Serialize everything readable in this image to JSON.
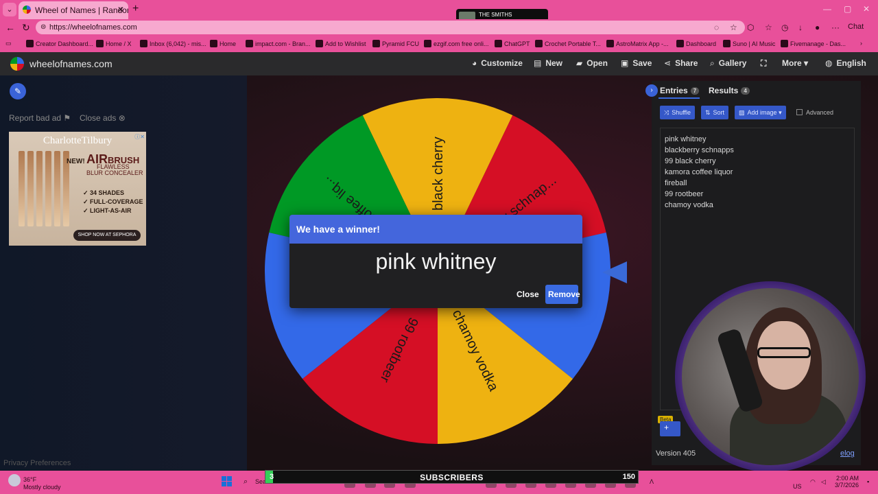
{
  "browser": {
    "tab_title": "Wheel of Names | Random name",
    "url": "https://wheelofnames.com",
    "chat_label": "Chat",
    "bookmarks": [
      "Creator Dashboard...",
      "Home / X",
      "Inbox (6,042) - mis...",
      "Home",
      "impact.com - Bran...",
      "Add to Wishlist",
      "Pyramid FCU",
      "ezgif.com free onli...",
      "ChatGPT",
      "Crochet Portable T...",
      "AstroMatrix App -...",
      "Dashboard",
      "Suno | AI Music",
      "Fivemanage - Das..."
    ]
  },
  "music": {
    "band": "THE SMITHS",
    "song": "I K"
  },
  "site": {
    "logo": "wheelofnames.com",
    "menu": {
      "customize": "Customize",
      "new": "New",
      "open": "Open",
      "save": "Save",
      "share": "Share",
      "gallery": "Gallery",
      "more": "More",
      "language": "English"
    }
  },
  "ads": {
    "report": "Report bad ad",
    "close": "Close ads",
    "brand": "CharlotteTilbury",
    "new": "NEW!",
    "air": "AIR",
    "brush": "BRUSH",
    "flawless": "FLAWLESS",
    "product": "BLUR CONCEALER",
    "bullets": [
      "✓ 34 SHADES",
      "✓ FULL-COVERAGE",
      "✓ LIGHT-AS-AIR"
    ],
    "cta": "SHOP NOW AT SEPHORA"
  },
  "privacy": "Privacy Preferences",
  "wheel": {
    "colors": [
      "#3369e8",
      "#d50f25",
      "#eeb211",
      "#009925"
    ],
    "segments": [
      {
        "label": "99 black cherry",
        "color": "#eeb211"
      },
      {
        "label": "blackberry schnap...",
        "color": "#d50f25"
      },
      {
        "label": "pink whitney",
        "color": "#3369e8"
      },
      {
        "label": "chamoy vodka",
        "color": "#eeb211"
      },
      {
        "label": "99 rootbeer",
        "color": "#d50f25"
      },
      {
        "label": "fireball",
        "color": "#3369e8"
      },
      {
        "label": "kamora coffee liq...",
        "color": "#009925"
      }
    ]
  },
  "dialog": {
    "title": "We have a winner!",
    "winner": "pink whitney",
    "close": "Close",
    "remove": "Remove"
  },
  "panel": {
    "tabs": {
      "entries": "Entries",
      "entries_count": "7",
      "results": "Results",
      "results_count": "4"
    },
    "buttons": {
      "shuffle": "Shuffle",
      "sort": "Sort",
      "add_image": "Add image",
      "advanced": "Advanced"
    },
    "entries": [
      "pink whitney",
      "blackberry schnapps",
      "99 black cherry",
      "kamora coffee liquor",
      "fireball",
      "99 rootbeer",
      "chamoy vodka"
    ],
    "beta": "Beta",
    "version": "Version 405",
    "changelog": "elog"
  },
  "taskbar": {
    "temp": "36°F",
    "condition": "Mostly cloudy",
    "search": "Search",
    "subscribers": {
      "count": "3",
      "label": "SUBSCRIBERS",
      "goal": "150",
      "progress": 0.02
    },
    "region": "US",
    "time": "2:00 AM",
    "date": "3/7/2026"
  }
}
